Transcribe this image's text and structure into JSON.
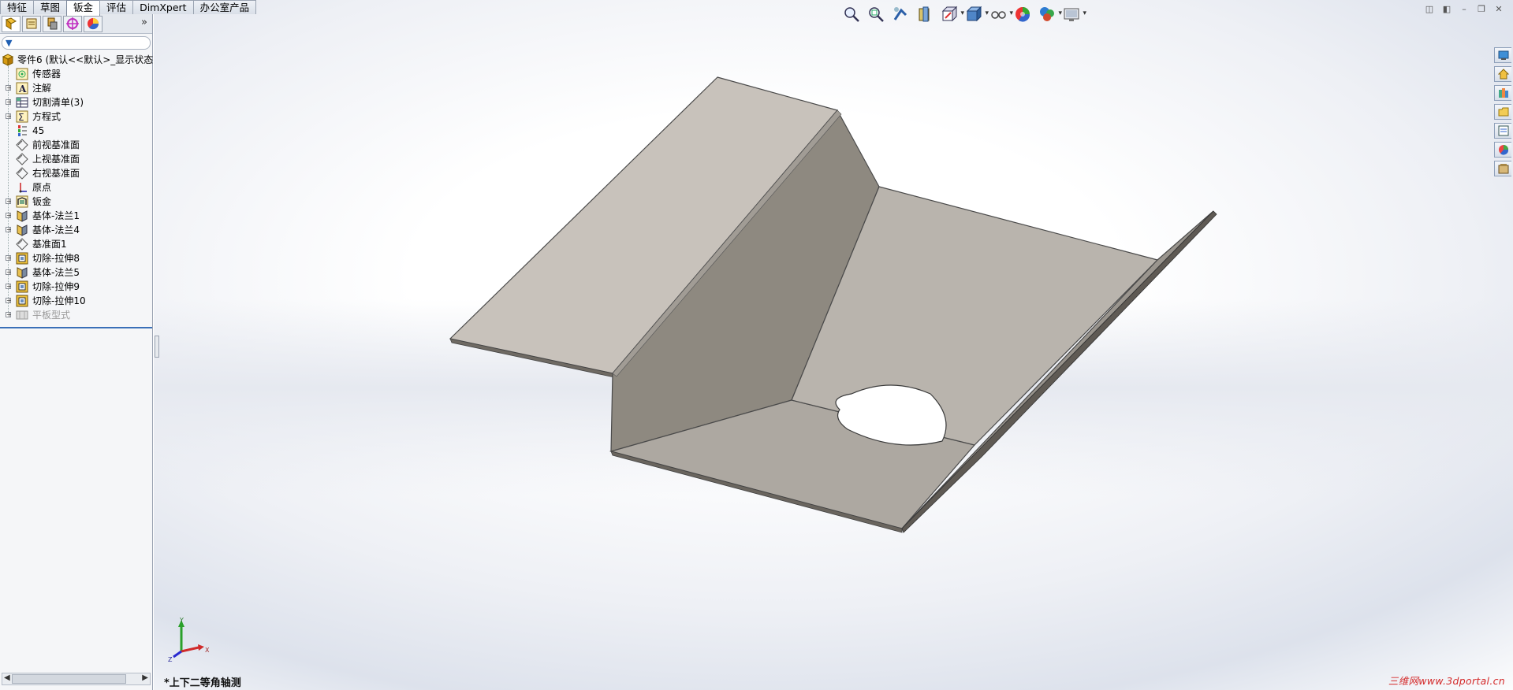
{
  "command_tabs": [
    {
      "label": "特征",
      "active": false
    },
    {
      "label": "草图",
      "active": false
    },
    {
      "label": "钣金",
      "active": true
    },
    {
      "label": "评估",
      "active": false
    },
    {
      "label": "DimXpert",
      "active": false
    },
    {
      "label": "办公室产品",
      "active": false
    }
  ],
  "panel": {
    "more_glyph": "»",
    "tree": {
      "root_label": "零件6 (默认<<默认>_显示状态",
      "items": [
        {
          "label": "传感器",
          "icon": "sensor-icon",
          "expandable": false
        },
        {
          "label": "注解",
          "icon": "annotation-icon",
          "expandable": true
        },
        {
          "label": "切割清单(3)",
          "icon": "cut-list-icon",
          "expandable": true
        },
        {
          "label": "方程式",
          "icon": "equation-icon",
          "expandable": true
        },
        {
          "label": "45",
          "icon": "material-icon",
          "expandable": false
        },
        {
          "label": "前视基准面",
          "icon": "plane-icon",
          "expandable": false
        },
        {
          "label": "上视基准面",
          "icon": "plane-icon",
          "expandable": false
        },
        {
          "label": "右视基准面",
          "icon": "plane-icon",
          "expandable": false
        },
        {
          "label": "原点",
          "icon": "origin-icon",
          "expandable": false
        },
        {
          "label": "钣金",
          "icon": "sheet-metal-icon",
          "expandable": true
        },
        {
          "label": "基体-法兰1",
          "icon": "base-flange-icon",
          "expandable": true
        },
        {
          "label": "基体-法兰4",
          "icon": "base-flange-icon",
          "expandable": true
        },
        {
          "label": "基准面1",
          "icon": "plane-icon",
          "expandable": false
        },
        {
          "label": "切除-拉伸8",
          "icon": "cut-extrude-icon",
          "expandable": true
        },
        {
          "label": "基体-法兰5",
          "icon": "base-flange-icon",
          "expandable": true
        },
        {
          "label": "切除-拉伸9",
          "icon": "cut-extrude-icon",
          "expandable": true
        },
        {
          "label": "切除-拉伸10",
          "icon": "cut-extrude-icon",
          "expandable": true
        },
        {
          "label": "平板型式",
          "icon": "flat-pattern-icon",
          "expandable": true,
          "suppressed": true
        }
      ]
    }
  },
  "viewport": {
    "view_name": "*上下二等角轴测",
    "watermark": "三维网www.3dportal.cn",
    "triad_labels": {
      "x": "X",
      "y": "Y",
      "z": "Z"
    }
  },
  "colors": {
    "selection_blue": "#3a6fb8",
    "watermark_red": "#d42a2a",
    "part_light": "#c8c2bb",
    "part_dark": "#8e8980"
  }
}
